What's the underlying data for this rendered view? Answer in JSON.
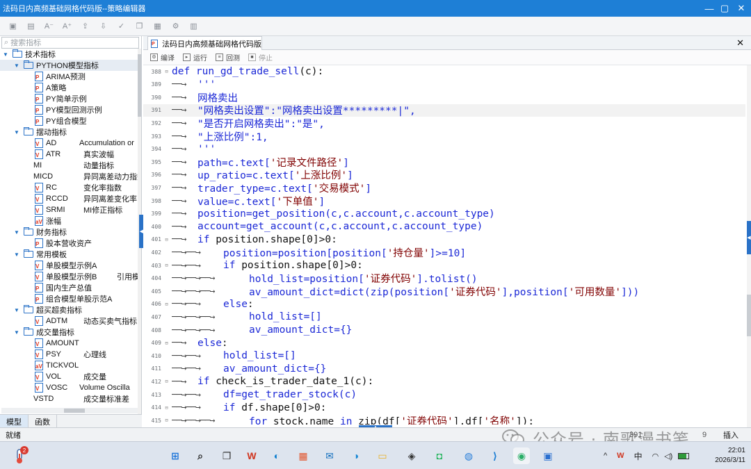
{
  "window": {
    "title": "法码日内高频基础网格代码版--策略编辑器",
    "controls": [
      "minimize-icon",
      "maximize-icon",
      "close-icon"
    ]
  },
  "toolbar_icons": [
    "save-icon",
    "save-as-icon",
    "font-decrease-icon",
    "font-increase-icon",
    "import-icon",
    "export-icon",
    "check-icon",
    "copy-icon",
    "doc-icon",
    "settings-icon",
    "doc-settings-icon"
  ],
  "sidebar": {
    "search_placeholder": "搜索指标",
    "tree": [
      {
        "label": "技术指标",
        "level": 0,
        "type": "folder",
        "expanded": true
      },
      {
        "label": "PYTHON模型指标",
        "level": 1,
        "type": "folder",
        "expanded": true,
        "selected": true
      },
      {
        "label": "ARIMA预测",
        "level": 2,
        "type": "py"
      },
      {
        "label": "A策略",
        "level": 2,
        "type": "py"
      },
      {
        "label": "PY简单示例",
        "level": 2,
        "type": "py"
      },
      {
        "label": "PY模型回测示例",
        "level": 2,
        "type": "py"
      },
      {
        "label": "PY组合模型",
        "level": 2,
        "type": "py"
      },
      {
        "label": "摆动指标",
        "level": 1,
        "type": "folder",
        "expanded": true
      },
      {
        "label": "AD",
        "desc": "Accumulation or",
        "level": 2,
        "type": "v"
      },
      {
        "label": "ATR",
        "desc": "真实波幅",
        "level": 2,
        "type": "v"
      },
      {
        "label": "MI",
        "desc": "动量指标",
        "level": 2,
        "type": "none"
      },
      {
        "label": "MICD",
        "desc": "异同离差动力指数",
        "level": 2,
        "type": "none"
      },
      {
        "label": "RC",
        "desc": "变化率指数",
        "level": 2,
        "type": "v"
      },
      {
        "label": "RCCD",
        "desc": "异同离差变化率",
        "level": 2,
        "type": "v"
      },
      {
        "label": "SRMI",
        "desc": "MI修正指标",
        "level": 2,
        "type": "v"
      },
      {
        "label": "涨幅",
        "level": 2,
        "type": "av"
      },
      {
        "label": "财务指标",
        "level": 1,
        "type": "folder",
        "expanded": true
      },
      {
        "label": "股本营收资产",
        "level": 2,
        "type": "py"
      },
      {
        "label": "常用模板",
        "level": 1,
        "type": "folder",
        "expanded": true
      },
      {
        "label": "单股模型示例A",
        "level": 2,
        "type": "v"
      },
      {
        "label": "单股模型示例B",
        "desc": "引用模",
        "level": 2,
        "type": "v"
      },
      {
        "label": "国内生产总值",
        "level": 2,
        "type": "py"
      },
      {
        "label": "组合模型单股示范A",
        "level": 2,
        "type": "py"
      },
      {
        "label": "超买超卖指标",
        "level": 1,
        "type": "folder",
        "expanded": true
      },
      {
        "label": "ADTM",
        "desc": "动态买卖气指标",
        "level": 2,
        "type": "v"
      },
      {
        "label": "成交量指标",
        "level": 1,
        "type": "folder",
        "expanded": true
      },
      {
        "label": "AMOUNT",
        "level": 2,
        "type": "v"
      },
      {
        "label": "PSY",
        "desc": "心理线",
        "level": 2,
        "type": "v"
      },
      {
        "label": "TICKVOL",
        "level": 2,
        "type": "av"
      },
      {
        "label": "VOL",
        "desc": "成交量",
        "level": 2,
        "type": "v"
      },
      {
        "label": "VOSC",
        "desc": "Volume Oscilla",
        "level": 2,
        "type": "v"
      },
      {
        "label": "VSTD",
        "desc": "成交量标准差",
        "level": 2,
        "type": "none"
      }
    ],
    "bottom_tabs": [
      "模型",
      "函数"
    ]
  },
  "editor": {
    "tab_title": "法码日内高频基础网格代码版",
    "toolbar": [
      "编译",
      "运行",
      "回测",
      "停止"
    ],
    "lines": [
      {
        "n": "388",
        "fold": "⊟",
        "indent": 0,
        "tokens": [
          {
            "t": "def run_gd_trade_sell",
            "c": "kw"
          },
          {
            "t": "(c):",
            "c": ""
          }
        ]
      },
      {
        "n": "389",
        "fold": "",
        "indent": 1,
        "tokens": [
          {
            "t": "'''",
            "c": "cm"
          }
        ]
      },
      {
        "n": "390",
        "fold": "",
        "indent": 1,
        "tokens": [
          {
            "t": "网格卖出",
            "c": "cm"
          }
        ]
      },
      {
        "n": "391",
        "fold": "",
        "indent": 1,
        "cur": true,
        "tokens": [
          {
            "t": "\"网格卖出设置\":\"网格卖出设置*********|\",",
            "c": "cm"
          }
        ]
      },
      {
        "n": "392",
        "fold": "",
        "indent": 1,
        "tokens": [
          {
            "t": "\"是否开启网格卖出\":\"是\",",
            "c": "cm"
          }
        ]
      },
      {
        "n": "393",
        "fold": "",
        "indent": 1,
        "tokens": [
          {
            "t": "\"上涨比例\":1,",
            "c": "cm"
          }
        ]
      },
      {
        "n": "394",
        "fold": "",
        "indent": 1,
        "tokens": [
          {
            "t": "'''",
            "c": "cm"
          }
        ]
      },
      {
        "n": "395",
        "fold": "",
        "indent": 1,
        "tokens": [
          {
            "t": "path=c.text[",
            "c": "kw"
          },
          {
            "t": "'记录文件路径'",
            "c": "str"
          },
          {
            "t": "]",
            "c": "kw"
          }
        ]
      },
      {
        "n": "396",
        "fold": "",
        "indent": 1,
        "tokens": [
          {
            "t": "up_ratio=c.text[",
            "c": "kw"
          },
          {
            "t": "'上涨比例'",
            "c": "str"
          },
          {
            "t": "]",
            "c": "kw"
          }
        ]
      },
      {
        "n": "397",
        "fold": "",
        "indent": 1,
        "tokens": [
          {
            "t": "trader_type=c.text[",
            "c": "kw"
          },
          {
            "t": "'交易模式'",
            "c": "str"
          },
          {
            "t": "]",
            "c": "kw"
          }
        ]
      },
      {
        "n": "398",
        "fold": "",
        "indent": 1,
        "tokens": [
          {
            "t": "value=c.text[",
            "c": "kw"
          },
          {
            "t": "'下单值'",
            "c": "str"
          },
          {
            "t": "]",
            "c": "kw"
          }
        ]
      },
      {
        "n": "399",
        "fold": "",
        "indent": 1,
        "tokens": [
          {
            "t": "position=get_position(c,c.account,c.account_type)",
            "c": "kw"
          }
        ]
      },
      {
        "n": "400",
        "fold": "",
        "indent": 1,
        "tokens": [
          {
            "t": "account=get_account(c,c.account,c.account_type)",
            "c": "kw"
          }
        ]
      },
      {
        "n": "401",
        "fold": "⊟",
        "indent": 1,
        "tokens": [
          {
            "t": "if",
            "c": "kw"
          },
          {
            "t": " position.shape[0]>0:",
            "c": ""
          }
        ]
      },
      {
        "n": "402",
        "fold": "",
        "indent": 2,
        "tokens": [
          {
            "t": "position=position[position[",
            "c": "kw"
          },
          {
            "t": "'持仓量'",
            "c": "str"
          },
          {
            "t": "]>=10]",
            "c": "kw"
          }
        ]
      },
      {
        "n": "403",
        "fold": "⊟",
        "indent": 2,
        "tokens": [
          {
            "t": "if",
            "c": "kw"
          },
          {
            "t": " position.shape[0]>0:",
            "c": ""
          }
        ]
      },
      {
        "n": "404",
        "fold": "",
        "indent": 3,
        "tokens": [
          {
            "t": "hold_list=position[",
            "c": "kw"
          },
          {
            "t": "'证券代码'",
            "c": "str"
          },
          {
            "t": "].tolist()",
            "c": "kw"
          }
        ]
      },
      {
        "n": "405",
        "fold": "",
        "indent": 3,
        "tokens": [
          {
            "t": "av_amount_dict=dict(zip(position[",
            "c": "kw"
          },
          {
            "t": "'证券代码'",
            "c": "str"
          },
          {
            "t": "],position[",
            "c": "kw"
          },
          {
            "t": "'可用数量'",
            "c": "str"
          },
          {
            "t": "]))",
            "c": "kw"
          }
        ]
      },
      {
        "n": "406",
        "fold": "⊟",
        "indent": 2,
        "tokens": [
          {
            "t": "else",
            "c": "kw"
          },
          {
            "t": ":",
            "c": ""
          }
        ]
      },
      {
        "n": "407",
        "fold": "",
        "indent": 3,
        "tokens": [
          {
            "t": "hold_list=[]",
            "c": "kw"
          }
        ]
      },
      {
        "n": "408",
        "fold": "",
        "indent": 3,
        "tokens": [
          {
            "t": "av_amount_dict={}",
            "c": "kw"
          }
        ]
      },
      {
        "n": "409",
        "fold": "⊟",
        "indent": 1,
        "tokens": [
          {
            "t": "else",
            "c": "kw"
          },
          {
            "t": ":",
            "c": ""
          }
        ]
      },
      {
        "n": "410",
        "fold": "",
        "indent": 2,
        "tokens": [
          {
            "t": "hold_list=[]",
            "c": "kw"
          }
        ]
      },
      {
        "n": "411",
        "fold": "",
        "indent": 2,
        "tokens": [
          {
            "t": "av_amount_dict={}",
            "c": "kw"
          }
        ]
      },
      {
        "n": "412",
        "fold": "⊟",
        "indent": 1,
        "tokens": [
          {
            "t": "if",
            "c": "kw"
          },
          {
            "t": " check_is_trader_date_1(c):",
            "c": ""
          }
        ]
      },
      {
        "n": "413",
        "fold": "",
        "indent": 2,
        "tokens": [
          {
            "t": "df=get_trader_stock(c)",
            "c": "kw"
          }
        ]
      },
      {
        "n": "414",
        "fold": "⊟",
        "indent": 2,
        "tokens": [
          {
            "t": "if",
            "c": "kw"
          },
          {
            "t": " df.shape[0]>0:",
            "c": ""
          }
        ]
      },
      {
        "n": "415",
        "fold": "⊟",
        "indent": 3,
        "tokens": [
          {
            "t": "for",
            "c": "kw"
          },
          {
            "t": " stock,name ",
            "c": ""
          },
          {
            "t": "in",
            "c": "kw"
          },
          {
            "t": " zip(df[",
            "c": ""
          },
          {
            "t": "'证券代码'",
            "c": "str"
          },
          {
            "t": "],df[",
            "c": ""
          },
          {
            "t": "'名称'",
            "c": "str"
          },
          {
            "t": "]):",
            "c": ""
          }
        ]
      }
    ]
  },
  "statusbar": {
    "left": "就绪",
    "position": "391,",
    "col": "9",
    "mode": "插入"
  },
  "watermark": "公众号 · 南歌漫书笺",
  "taskbar": {
    "weather_badge": "2",
    "apps": [
      "windows-icon",
      "search-icon",
      "task-view-icon",
      "wps-icon",
      "edge-icon",
      "store-icon",
      "outlook-icon",
      "edge-ai-icon",
      "file-explorer-icon",
      "cube-app-icon",
      "green-app-icon",
      "chart-app-icon",
      "vscode-icon",
      "wechat-icon",
      "photo-app-icon"
    ],
    "tray_chevron": "^",
    "ime": "中",
    "time": "22:01",
    "date": "2026/3/11"
  },
  "colors": {
    "titlebar": "#1e7fd6",
    "keyword": "#1b28d6",
    "string": "#800000",
    "accent": "#2a72c7"
  }
}
